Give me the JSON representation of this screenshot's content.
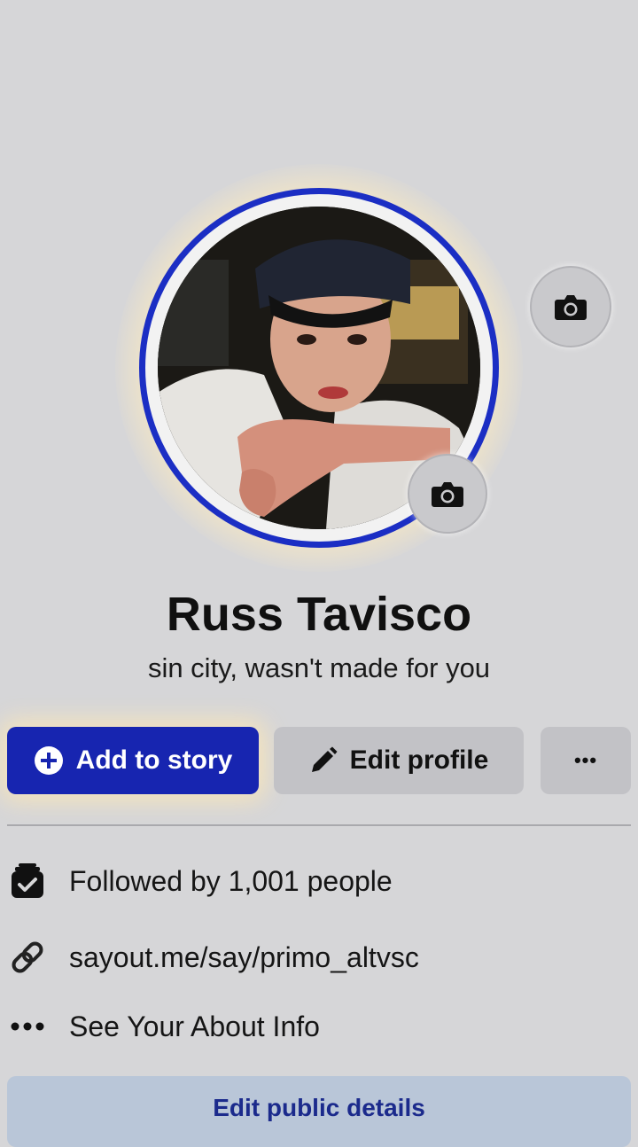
{
  "profile": {
    "name": "Russ Tavisco",
    "bio": "sin city, wasn't made for you"
  },
  "actions": {
    "add_story": "Add to story",
    "edit_profile": "Edit profile",
    "more": "•••"
  },
  "details": {
    "followers": "Followed by 1,001 people",
    "link": "sayout.me/say/primo_altvsc",
    "about": "See Your About Info",
    "edit_public": "Edit public details"
  },
  "icons": {
    "cover_camera": "camera-icon",
    "avatar_camera": "camera-icon",
    "add_story": "plus-circle-icon",
    "edit_profile": "pencil-icon",
    "more": "more-horizontal-icon",
    "followers": "followers-icon",
    "link": "link-icon",
    "about": "more-dots-icon"
  },
  "colors": {
    "accent": "#1725b0",
    "avatar_ring": "#1b2ec4",
    "link_text": "#1b2a8c",
    "background": "#d6d6d8"
  }
}
